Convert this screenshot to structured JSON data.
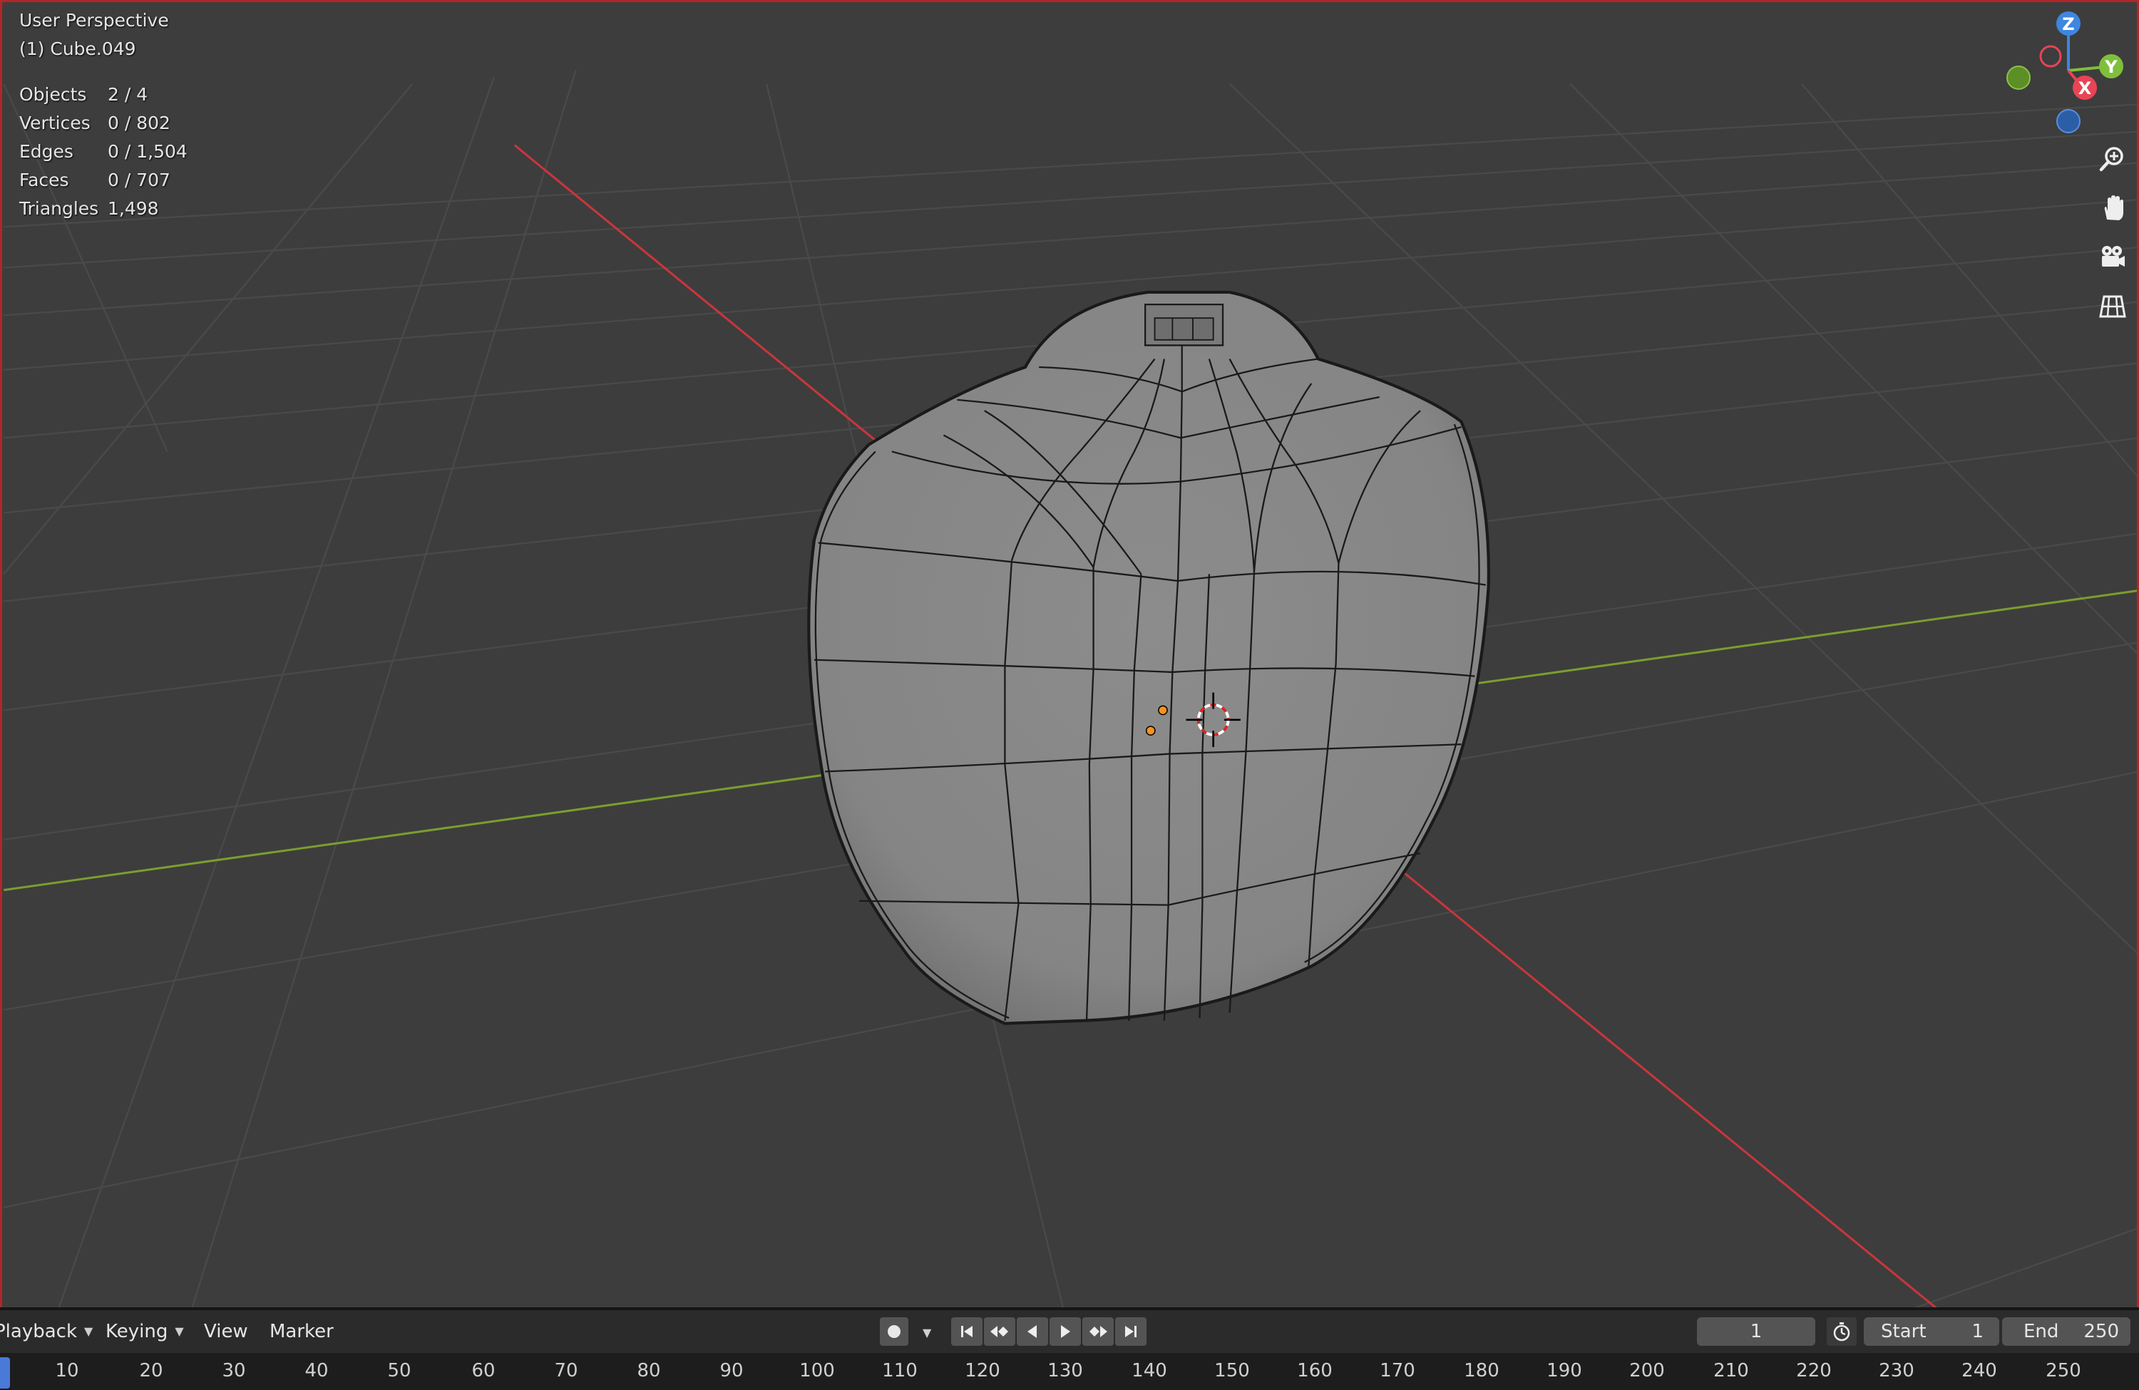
{
  "viewport": {
    "view_name": "User Perspective",
    "object_name": "(1) Cube.049",
    "stats": [
      {
        "label": "Objects",
        "value": "2 / 4"
      },
      {
        "label": "Vertices",
        "value": "0 / 802"
      },
      {
        "label": "Edges",
        "value": "0 / 1,504"
      },
      {
        "label": "Faces",
        "value": "0 / 707"
      },
      {
        "label": "Triangles",
        "value": "1,498"
      }
    ]
  },
  "gizmo": {
    "axes": {
      "z": "Z",
      "y": "Y",
      "x": "X"
    },
    "colors": {
      "x": "#e84455",
      "y": "#7fbf3b",
      "z": "#3e86e0"
    }
  },
  "nav_icons": [
    "zoom-icon",
    "pan-hand-icon",
    "camera-icon",
    "ortho-grid-icon"
  ],
  "timeline": {
    "menus": {
      "playback": "Playback",
      "keying": "Keying",
      "view": "View",
      "marker": "Marker"
    },
    "current_frame": "1",
    "start_label": "Start",
    "start_value": "1",
    "end_label": "End",
    "end_value": "250",
    "ruler_ticks": [
      "10",
      "20",
      "30",
      "40",
      "50",
      "60",
      "70",
      "80",
      "90",
      "100",
      "110",
      "120",
      "130",
      "140",
      "150",
      "160",
      "170",
      "180",
      "190",
      "200",
      "210",
      "220",
      "230",
      "240",
      "250"
    ]
  },
  "colors": {
    "viewport_bg": "#3d3d3d",
    "x_axis": "#c8363c",
    "y_axis": "#7a9e2e",
    "mesh": "#8a8a8a",
    "frame_marker": "#4a7ad8"
  }
}
